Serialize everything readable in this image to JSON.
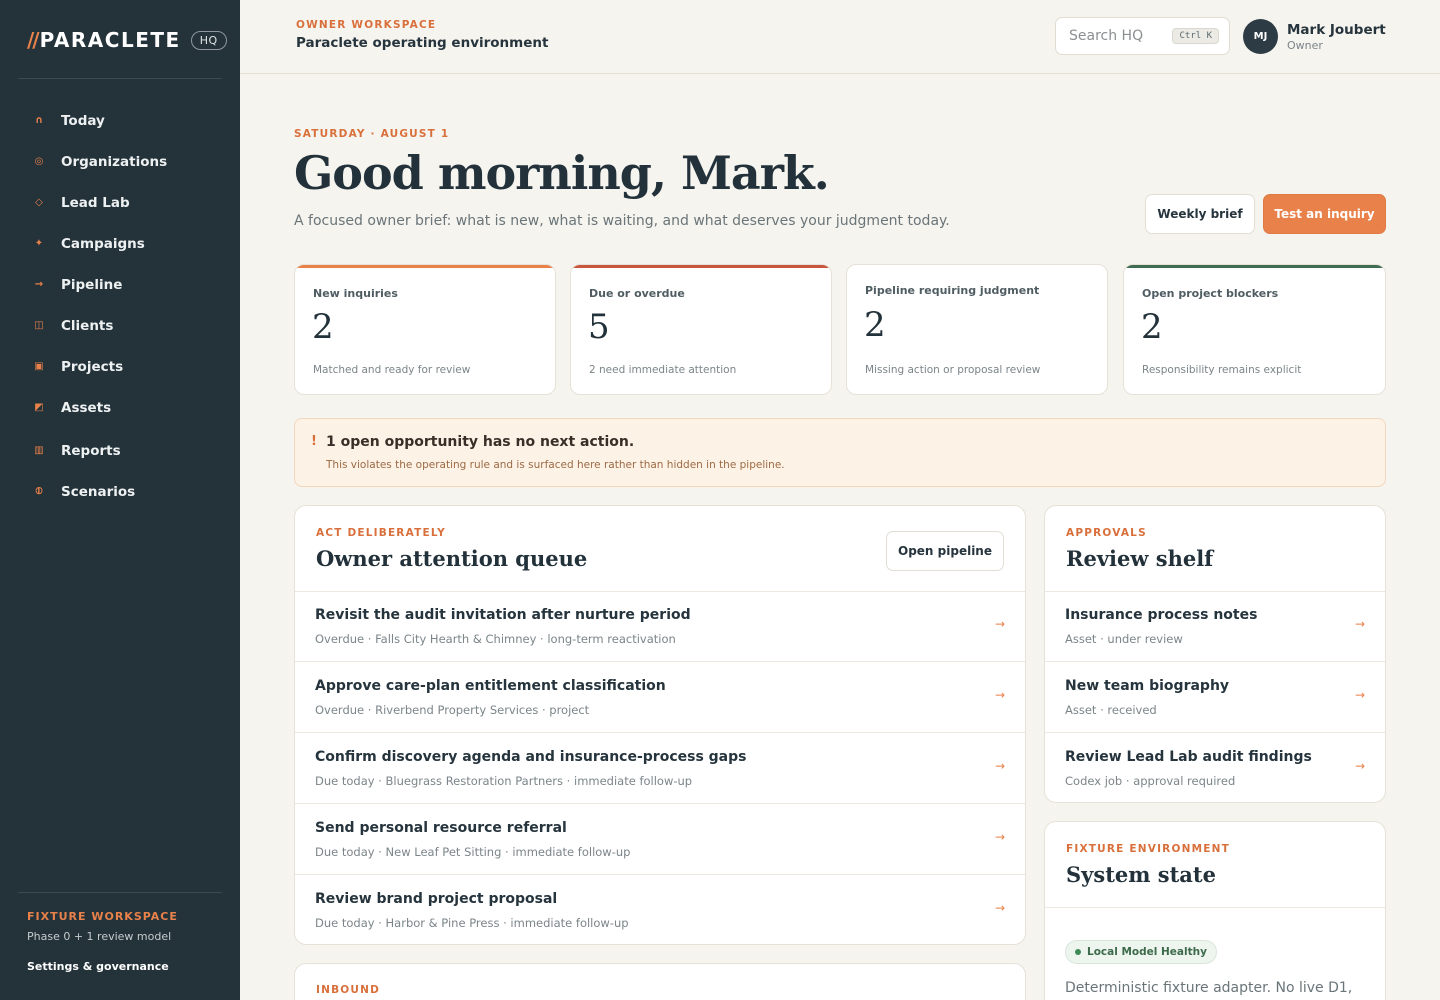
{
  "sidebar": {
    "brand": {
      "slash": "//",
      "name": "PARACLETE",
      "badge": "HQ"
    },
    "nav": [
      {
        "icon": "today-icon",
        "glyph": "∩",
        "label": "Today"
      },
      {
        "icon": "organizations-icon",
        "glyph": "◎",
        "label": "Organizations"
      },
      {
        "icon": "lead-lab-icon",
        "glyph": "◇",
        "label": "Lead Lab"
      },
      {
        "icon": "campaigns-icon",
        "glyph": "✦",
        "label": "Campaigns"
      },
      {
        "icon": "pipeline-icon",
        "glyph": "→",
        "label": "Pipeline"
      },
      {
        "icon": "clients-icon",
        "glyph": "◫",
        "label": "Clients"
      },
      {
        "icon": "projects-icon",
        "glyph": "▣",
        "label": "Projects"
      },
      {
        "icon": "assets-icon",
        "glyph": "◩",
        "label": "Assets"
      },
      {
        "icon": "reports-icon",
        "glyph": "▥",
        "label": "Reports"
      },
      {
        "icon": "scenarios-icon",
        "glyph": "⦶",
        "label": "Scenarios"
      }
    ],
    "footer": {
      "eyebrow": "FIXTURE WORKSPACE",
      "subtitle": "Phase 0 + 1 review model",
      "link": "Settings & governance"
    }
  },
  "topbar": {
    "eyebrow": "OWNER WORKSPACE",
    "title": "Paraclete operating environment",
    "search": {
      "placeholder": "Search HQ",
      "shortcut": "Ctrl K"
    },
    "user": {
      "initials": "MJ",
      "name": "Mark Joubert",
      "role": "Owner"
    }
  },
  "hero": {
    "date": "SATURDAY · AUGUST 1",
    "greeting": "Good morning, Mark.",
    "lead": "A focused owner brief: what is new, what is waiting, and what deserves your judgment today.",
    "weekly_brief": "Weekly brief",
    "test_inquiry": "Test an inquiry"
  },
  "colors": {
    "accent": "#e8814a",
    "sidebar_bg": "#24323a",
    "metric_accents": [
      "#e8814a",
      "#c8553d",
      "#f2f0ea",
      "#3f6b52"
    ]
  },
  "metrics": [
    {
      "label": "New inquiries",
      "value": "2",
      "note": "Matched and ready for review"
    },
    {
      "label": "Due or overdue",
      "value": "5",
      "note": "2 need immediate attention"
    },
    {
      "label": "Pipeline requiring judgment",
      "value": "2",
      "note": "Missing action or proposal review"
    },
    {
      "label": "Open project blockers",
      "value": "2",
      "note": "Responsibility remains explicit"
    }
  ],
  "alert": {
    "icon": "!",
    "title": "1 open opportunity has no next action.",
    "subtitle": "This violates the operating rule and is surfaced here rather than hidden in the pipeline."
  },
  "queue": {
    "eyebrow": "ACT DELIBERATELY",
    "title": "Owner attention queue",
    "button": "Open pipeline",
    "items": [
      {
        "title": "Revisit the audit invitation after nurture period",
        "meta": "Overdue · Falls City Hearth & Chimney · long-term reactivation"
      },
      {
        "title": "Approve care-plan entitlement classification",
        "meta": "Overdue · Riverbend Property Services · project"
      },
      {
        "title": "Confirm discovery agenda and insurance-process gaps",
        "meta": "Due today · Bluegrass Restoration Partners · immediate follow-up"
      },
      {
        "title": "Send personal resource referral",
        "meta": "Due today · New Leaf Pet Sitting · immediate follow-up"
      },
      {
        "title": "Review brand project proposal",
        "meta": "Due today · Harbor & Pine Press · immediate follow-up"
      }
    ]
  },
  "inbound": {
    "eyebrow": "INBOUND"
  },
  "review": {
    "eyebrow": "APPROVALS",
    "title": "Review shelf",
    "items": [
      {
        "title": "Insurance process notes",
        "meta": "Asset · under review"
      },
      {
        "title": "New team biography",
        "meta": "Asset · received"
      },
      {
        "title": "Review Lead Lab audit findings",
        "meta": "Codex job · approval required"
      }
    ]
  },
  "system": {
    "eyebrow": "FIXTURE ENVIRONMENT",
    "title": "System state",
    "status": "Local Model Healthy",
    "text": "Deterministic fixture adapter. No live D1,"
  }
}
